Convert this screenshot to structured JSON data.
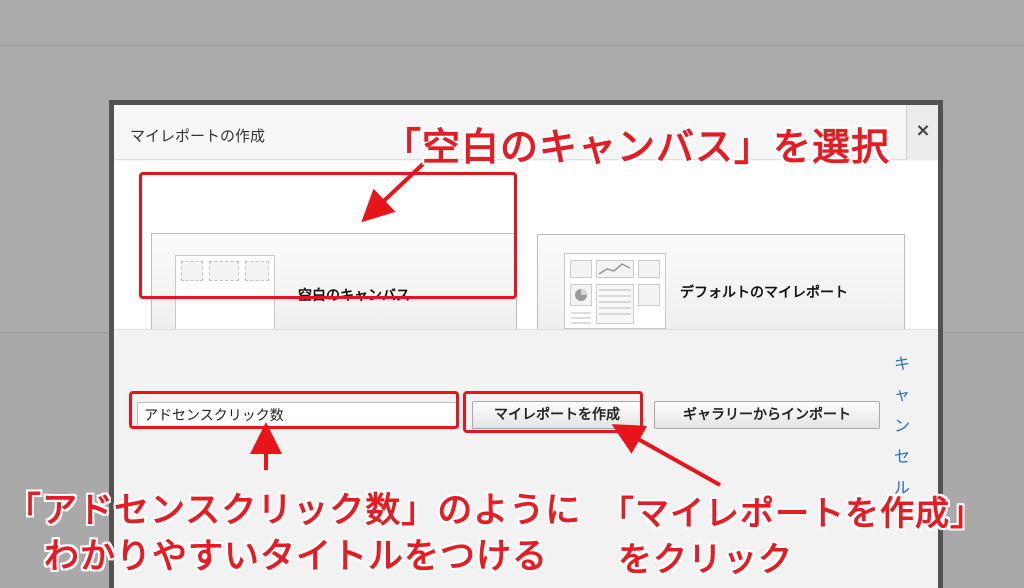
{
  "dialog": {
    "title": "マイレポートの作成",
    "close_label": "×",
    "options": {
      "blank_canvas": "空白のキャンバス",
      "default_report": "デフォルトのマイレポート"
    },
    "title_input_value": "アドセンスクリック数",
    "create_button": "マイレポートを作成",
    "import_button": "ギャラリーからインポート",
    "cancel_chars": [
      "キ",
      "ャ",
      "ン",
      "セ",
      "ル"
    ]
  },
  "annotations": {
    "select_blank": "「空白のキャンバス」を選択",
    "title_hint_line1": "「アドセンスクリック数」のように",
    "title_hint_line2": "わかりやすいタイトルをつける",
    "click_create_line1": "「マイレポートを作成」",
    "click_create_line2": "をクリック",
    "color": "#e51c23"
  },
  "icons": [
    "close-icon",
    "blank-canvas-thumbnail-icon",
    "default-report-thumbnail-icon"
  ]
}
